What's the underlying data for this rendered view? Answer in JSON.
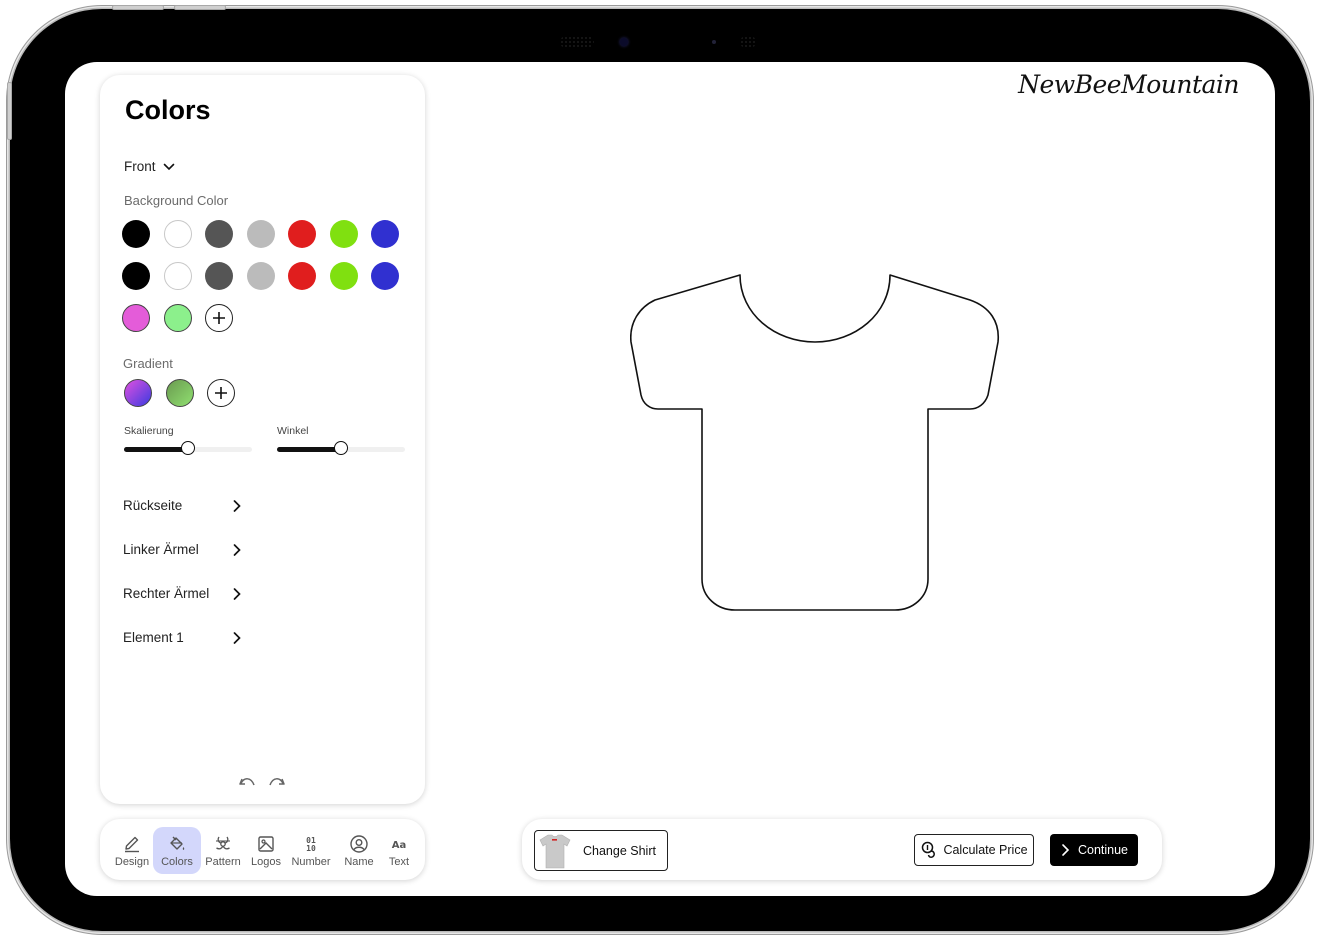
{
  "panel": {
    "title": "Colors",
    "side_selector": "Front",
    "background_color_label": "Background Color",
    "background_swatches_row1": [
      {
        "name": "black",
        "color": "#000000"
      },
      {
        "name": "white",
        "color": "#ffffff"
      },
      {
        "name": "dark-gray",
        "color": "#555555"
      },
      {
        "name": "light-gray",
        "color": "#bbbbbb"
      },
      {
        "name": "red",
        "color": "#e01e1e"
      },
      {
        "name": "lime",
        "color": "#80e010"
      },
      {
        "name": "blue",
        "color": "#3030d0"
      }
    ],
    "background_swatches_row2": [
      {
        "name": "black",
        "color": "#000000"
      },
      {
        "name": "white",
        "color": "#ffffff"
      },
      {
        "name": "dark-gray",
        "color": "#555555"
      },
      {
        "name": "light-gray",
        "color": "#bbbbbb"
      },
      {
        "name": "red",
        "color": "#e01e1e"
      },
      {
        "name": "lime",
        "color": "#80e010"
      },
      {
        "name": "blue",
        "color": "#3030d0"
      }
    ],
    "custom_swatches": [
      {
        "name": "magenta",
        "color": "#e45cd9"
      },
      {
        "name": "mint",
        "color": "#8cf08c"
      }
    ],
    "gradient_label": "Gradient",
    "gradients": [
      {
        "name": "blue-magenta",
        "from": "#3b3be0",
        "to": "#e050e0"
      },
      {
        "name": "green",
        "from": "#90e070",
        "to": "#6a9a50"
      }
    ],
    "sliders": [
      {
        "label": "Skalierung",
        "value_fraction": 0.5
      },
      {
        "label": "Winkel",
        "value_fraction": 0.5
      }
    ],
    "sections": [
      "Rückseite",
      "Linker Ärmel",
      "Rechter Ärmel",
      "Element 1"
    ]
  },
  "toolbar": {
    "items": [
      {
        "label": "Design",
        "icon": "pencil-icon",
        "active": false
      },
      {
        "label": "Colors",
        "icon": "paint-bucket-icon",
        "active": true
      },
      {
        "label": "Pattern",
        "icon": "biohazard-icon",
        "active": false
      },
      {
        "label": "Logos",
        "icon": "image-icon",
        "active": false
      },
      {
        "label": "Number",
        "icon": "binary-icon",
        "active": false
      },
      {
        "label": "Name",
        "icon": "user-circle-icon",
        "active": false
      },
      {
        "label": "Text",
        "icon": "text-icon",
        "active": false
      }
    ]
  },
  "brand": {
    "logo_text": "NewBeeMountain"
  },
  "actions": {
    "change_shirt": "Change Shirt",
    "calculate_price": "Calculate Price",
    "continue": "Continue",
    "accent": "#000000"
  }
}
